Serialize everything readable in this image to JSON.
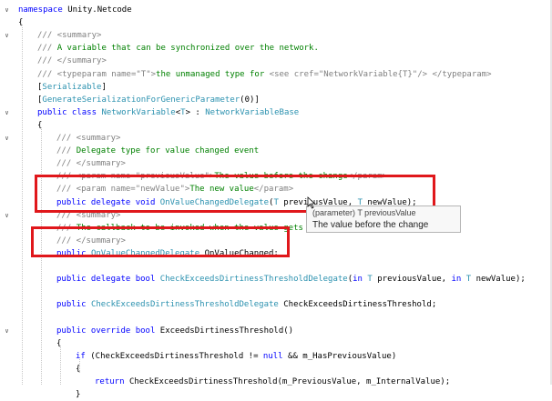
{
  "editor": {
    "lines": [
      {
        "indent": 0,
        "fold": "collapse",
        "tokens": [
          [
            "kw",
            "namespace"
          ],
          [
            "plain",
            " Unity.Netcode"
          ]
        ]
      },
      {
        "indent": 0,
        "fold": "",
        "tokens": [
          [
            "plain",
            "{"
          ]
        ]
      },
      {
        "indent": 1,
        "fold": "collapse",
        "tokens": [
          [
            "xml",
            "/// <summary>"
          ]
        ]
      },
      {
        "indent": 1,
        "fold": "",
        "tokens": [
          [
            "xml",
            "/// "
          ],
          [
            "cmt",
            "A variable that can be synchronized over the network."
          ]
        ]
      },
      {
        "indent": 1,
        "fold": "",
        "tokens": [
          [
            "xml",
            "/// </summary>"
          ]
        ]
      },
      {
        "indent": 1,
        "fold": "",
        "tokens": [
          [
            "xml",
            "/// <typeparam name=\"T\">"
          ],
          [
            "cmt",
            "the unmanaged type for "
          ],
          [
            "xml",
            "<see cref=\"NetworkVariable{T}\"/> </typeparam>"
          ]
        ]
      },
      {
        "indent": 1,
        "fold": "",
        "tokens": [
          [
            "plain",
            "["
          ],
          [
            "type",
            "Serializable"
          ],
          [
            "plain",
            "]"
          ]
        ]
      },
      {
        "indent": 1,
        "fold": "",
        "tokens": [
          [
            "plain",
            "["
          ],
          [
            "type",
            "GenerateSerializationForGenericParameter"
          ],
          [
            "plain",
            "(0)]"
          ]
        ]
      },
      {
        "indent": 1,
        "fold": "collapse",
        "tokens": [
          [
            "kw",
            "public class "
          ],
          [
            "type",
            "NetworkVariable"
          ],
          [
            "plain",
            "<"
          ],
          [
            "type",
            "T"
          ],
          [
            "plain",
            "> : "
          ],
          [
            "type",
            "NetworkVariableBase"
          ]
        ]
      },
      {
        "indent": 1,
        "fold": "",
        "tokens": [
          [
            "plain",
            "{"
          ]
        ]
      },
      {
        "indent": 2,
        "fold": "collapse",
        "tokens": [
          [
            "xml",
            "/// <summary>"
          ]
        ]
      },
      {
        "indent": 2,
        "fold": "",
        "tokens": [
          [
            "xml",
            "/// "
          ],
          [
            "cmt",
            "Delegate type for value changed event"
          ]
        ]
      },
      {
        "indent": 2,
        "fold": "",
        "tokens": [
          [
            "xml",
            "/// </summary>"
          ]
        ]
      },
      {
        "indent": 2,
        "fold": "",
        "tokens": [
          [
            "xml",
            "/// <param name=\"previousValue\">"
          ],
          [
            "cmt",
            "The value before the change"
          ],
          [
            "xml",
            "</param>"
          ]
        ]
      },
      {
        "indent": 2,
        "fold": "",
        "tokens": [
          [
            "xml",
            "/// <param name=\"newValue\">"
          ],
          [
            "cmt",
            "The new value"
          ],
          [
            "xml",
            "</param>"
          ]
        ]
      },
      {
        "indent": 2,
        "fold": "",
        "tokens": [
          [
            "kw",
            "public delegate void "
          ],
          [
            "type",
            "OnValueChangedDelegate"
          ],
          [
            "plain",
            "("
          ],
          [
            "type",
            "T"
          ],
          [
            "plain",
            " previousValue, "
          ],
          [
            "type",
            "T"
          ],
          [
            "plain",
            " newValue);"
          ]
        ]
      },
      {
        "indent": 2,
        "fold": "collapse",
        "tokens": [
          [
            "xml",
            "/// <summary>"
          ]
        ]
      },
      {
        "indent": 2,
        "fold": "",
        "tokens": [
          [
            "xml",
            "/// "
          ],
          [
            "cmt",
            "The callback to be invoked when the value gets c"
          ]
        ]
      },
      {
        "indent": 2,
        "fold": "",
        "tokens": [
          [
            "xml",
            "/// </summary>"
          ]
        ]
      },
      {
        "indent": 2,
        "fold": "",
        "tokens": [
          [
            "kw",
            "public "
          ],
          [
            "type",
            "OnValueChangedDelegate"
          ],
          [
            "plain",
            " OnValueChanged;"
          ]
        ]
      },
      {
        "indent": 2,
        "fold": "",
        "tokens": []
      },
      {
        "indent": 2,
        "fold": "",
        "tokens": [
          [
            "kw",
            "public delegate bool "
          ],
          [
            "type",
            "CheckExceedsDirtinessThresholdDelegate"
          ],
          [
            "plain",
            "("
          ],
          [
            "kw",
            "in "
          ],
          [
            "type",
            "T"
          ],
          [
            "plain",
            " previousValue, "
          ],
          [
            "kw",
            "in "
          ],
          [
            "type",
            "T"
          ],
          [
            "plain",
            " newValue);"
          ]
        ]
      },
      {
        "indent": 2,
        "fold": "",
        "tokens": []
      },
      {
        "indent": 2,
        "fold": "",
        "tokens": [
          [
            "kw",
            "public "
          ],
          [
            "type",
            "CheckExceedsDirtinessThresholdDelegate"
          ],
          [
            "plain",
            " CheckExceedsDirtinessThreshold;"
          ]
        ]
      },
      {
        "indent": 2,
        "fold": "",
        "tokens": []
      },
      {
        "indent": 2,
        "fold": "collapse",
        "tokens": [
          [
            "kw",
            "public override bool "
          ],
          [
            "plain",
            "ExceedsDirtinessThreshold()"
          ]
        ]
      },
      {
        "indent": 2,
        "fold": "",
        "tokens": [
          [
            "plain",
            "{"
          ]
        ]
      },
      {
        "indent": 3,
        "fold": "",
        "tokens": [
          [
            "kw",
            "if "
          ],
          [
            "plain",
            "(CheckExceedsDirtinessThreshold != "
          ],
          [
            "kw",
            "null"
          ],
          [
            "plain",
            " && m_HasPreviousValue)"
          ]
        ]
      },
      {
        "indent": 3,
        "fold": "",
        "tokens": [
          [
            "plain",
            "{"
          ]
        ]
      },
      {
        "indent": 4,
        "fold": "",
        "tokens": [
          [
            "kw",
            "return "
          ],
          [
            "plain",
            "CheckExceedsDirtinessThreshold(m_PreviousValue, m_InternalValue);"
          ]
        ]
      },
      {
        "indent": 3,
        "fold": "",
        "tokens": [
          [
            "plain",
            "}"
          ]
        ]
      }
    ]
  },
  "tooltip": {
    "signature": "(parameter) T previousValue",
    "description": "The value before the change"
  },
  "colors": {
    "highlight_box": "#e0171b",
    "keyword": "#0000ff",
    "type": "#2b91af",
    "comment": "#008000",
    "xml_doc": "#808080"
  },
  "icons": {
    "fold": "chevron-down-icon",
    "pointer": "mouse-pointer-icon"
  }
}
